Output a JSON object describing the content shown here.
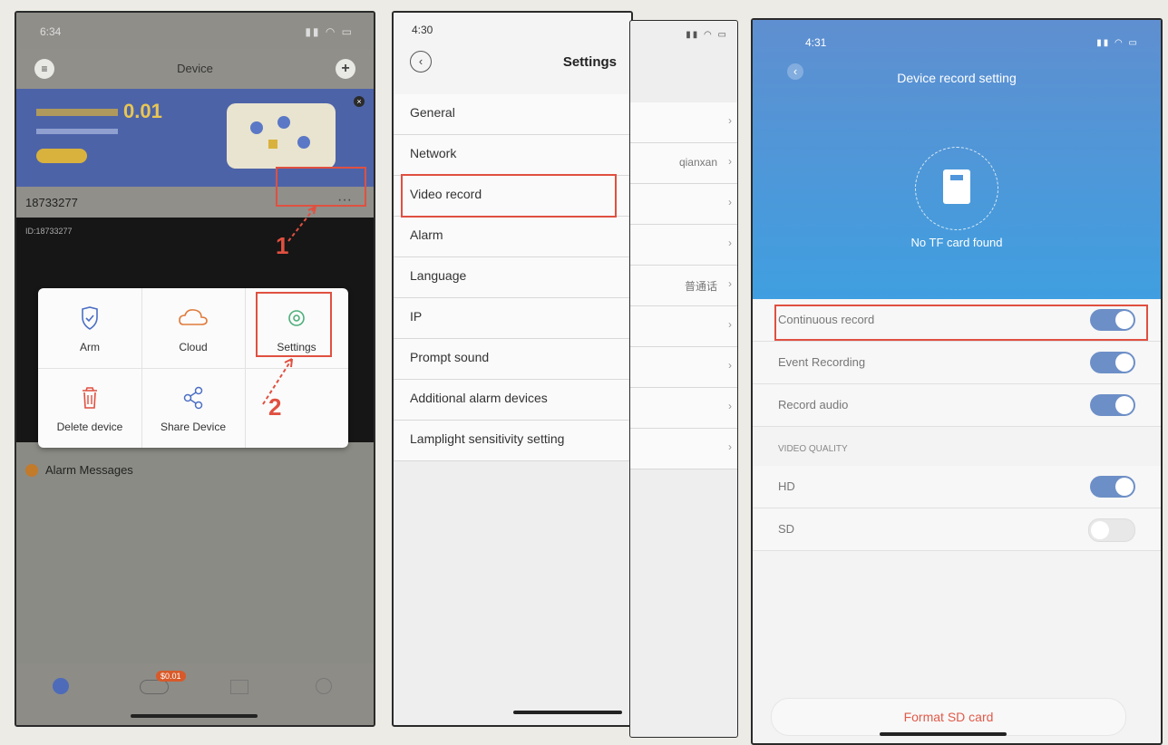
{
  "phone1": {
    "status": {
      "time": "6:34",
      "signal_icon": "signal-wifi-battery-icons"
    },
    "header": {
      "title": "Device",
      "menu_icon": "list-icon",
      "add_icon": "plus-icon"
    },
    "banner": {
      "amount": "0.01"
    },
    "device": {
      "id": "18733277",
      "more": "···",
      "camera_id": "ID:18733277"
    },
    "menu": [
      {
        "label": "Arm",
        "icon": "shield-icon"
      },
      {
        "label": "Cloud",
        "icon": "cloud-icon"
      },
      {
        "label": "Settings",
        "icon": "gear-icon"
      },
      {
        "label": "Delete device",
        "icon": "trash-icon"
      },
      {
        "label": "Share Device",
        "icon": "share-icon"
      }
    ],
    "alarm_messages": "Alarm Messages",
    "annotations": {
      "step1": "1",
      "step2": "2"
    },
    "tabbar": {
      "cloud_badge": "$0.01"
    }
  },
  "phone2": {
    "status": {
      "time": "4:30"
    },
    "header": {
      "title": "Settings",
      "back_icon": "back-icon"
    },
    "items": [
      {
        "label": "General",
        "value": ""
      },
      {
        "label": "Network",
        "value": "qianxan"
      },
      {
        "label": "Video record",
        "value": ""
      },
      {
        "label": "Alarm",
        "value": ""
      },
      {
        "label": "Language",
        "value": "普通话"
      },
      {
        "label": "IP",
        "value": ""
      },
      {
        "label": "Prompt sound",
        "value": ""
      },
      {
        "label": "Additional alarm devices",
        "value": ""
      },
      {
        "label": "Lamplight sensitivity setting",
        "value": ""
      }
    ]
  },
  "phone3": {
    "status": {
      "time": "4:31"
    },
    "header": {
      "title": "Device record setting",
      "back_icon": "back-icon"
    },
    "sd_status": "No TF card found",
    "toggles": [
      {
        "label": "Continuous record",
        "on": true
      },
      {
        "label": "Event Recording",
        "on": true
      },
      {
        "label": "Record audio",
        "on": true
      }
    ],
    "quality_section": "VIDEO QUALITY",
    "quality": [
      {
        "label": "HD",
        "on": true
      },
      {
        "label": "SD",
        "on": false
      }
    ],
    "format_button": "Format SD card"
  },
  "colors": {
    "highlight": "#e05040",
    "toggle_on": "#6d8fc7",
    "header_blue": "#4f96dc"
  }
}
